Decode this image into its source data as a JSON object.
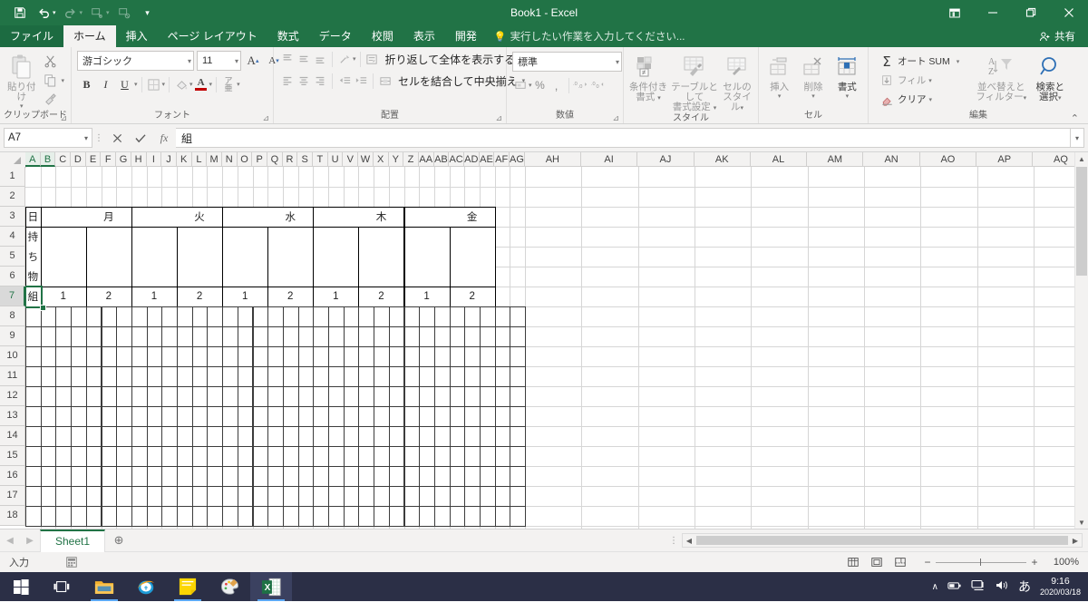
{
  "titlebar": {
    "document_title": "Book1 - Excel",
    "qat": [
      {
        "name": "save",
        "icon": "save-icon"
      },
      {
        "name": "undo",
        "icon": "undo-icon"
      },
      {
        "name": "redo",
        "icon": "redo-icon"
      },
      {
        "name": "touch-mode",
        "icon": "touch-icon"
      },
      {
        "name": "clear-all",
        "icon": "clear-icon"
      },
      {
        "name": "customize",
        "icon": "chevron-down-icon"
      }
    ],
    "ribbon_display": "ribbon-display-options-icon",
    "minimize": "minimize-icon",
    "restore": "restore-icon",
    "close": "close-icon"
  },
  "ribbon_tabs": {
    "file": "ファイル",
    "items": [
      "ホーム",
      "挿入",
      "ページ レイアウト",
      "数式",
      "データ",
      "校閲",
      "表示",
      "開発"
    ],
    "active": "ホーム",
    "tellme": "実行したい作業を入力してください...",
    "share": "共有"
  },
  "ribbon": {
    "clipboard": {
      "caption": "クリップボード",
      "paste": "貼り付け",
      "cut": "cut-icon",
      "copy": "copy-icon",
      "format_painter": "format-painter-icon"
    },
    "font": {
      "caption": "フォント",
      "font_name": "游ゴシック",
      "font_size": "11",
      "grow": "A",
      "shrink": "A",
      "bold": "B",
      "italic": "I",
      "underline": "U",
      "borders": "borders-icon",
      "fill_color": "fill-color-icon",
      "font_color": "A",
      "phonetic": "ア亜"
    },
    "alignment": {
      "caption": "配置",
      "wrap_text": "折り返して全体を表示する",
      "merge_center": "セルを結合して中央揃え",
      "orientation": "orientation-icon",
      "decrease_indent": "decrease-indent-icon",
      "increase_indent": "increase-indent-icon"
    },
    "number": {
      "caption": "数値",
      "format": "標準",
      "accounting": "accounting-icon",
      "percent": "%",
      "comma": ",",
      "increase_decimal": "増",
      "decrease_decimal": "減"
    },
    "styles": {
      "caption": "スタイル",
      "conditional": "条件付き\n書式",
      "conditional_l1": "条件付き",
      "conditional_l2": "書式",
      "table_l1": "テーブルとして",
      "table_l2": "書式設定",
      "cellstyle_l1": "セルの",
      "cellstyle_l2": "スタイル"
    },
    "cells": {
      "caption": "セル",
      "insert": "挿入",
      "delete": "削除",
      "format": "書式"
    },
    "editing": {
      "caption": "編集",
      "autosum": "オート SUM",
      "fill": "フィル",
      "clear": "クリア",
      "sort_l1": "並べ替えと",
      "sort_l2": "フィルター",
      "find_l1": "検索と",
      "find_l2": "選択",
      "collapse": "collapse-ribbon-icon"
    }
  },
  "formula_bar": {
    "name_box": "A7",
    "cancel": "cancel-icon",
    "enter": "enter-icon",
    "insert_function": "fx",
    "value": "組"
  },
  "sheet": {
    "column_headers": [
      "A",
      "B",
      "C",
      "D",
      "E",
      "F",
      "G",
      "H",
      "I",
      "J",
      "K",
      "L",
      "M",
      "N",
      "O",
      "P",
      "Q",
      "R",
      "S",
      "T",
      "U",
      "V",
      "W",
      "X",
      "Y",
      "Z",
      "AA",
      "AB",
      "AC",
      "AD",
      "AE",
      "AF",
      "AG",
      "AH",
      "AI",
      "AJ",
      "AK",
      "AL",
      "AM",
      "AN",
      "AO",
      "AP",
      "AQ"
    ],
    "selected_columns": [
      "A",
      "B"
    ],
    "row_headers": [
      "1",
      "2",
      "3",
      "4",
      "5",
      "6",
      "7",
      "8",
      "9",
      "10",
      "11",
      "12",
      "13",
      "14",
      "15",
      "16",
      "17",
      "18"
    ],
    "selected_row": "7",
    "active_cell": "A7",
    "day_headers": [
      "日",
      "月",
      "火",
      "水",
      "木",
      "金"
    ],
    "row_label_chars": [
      "持",
      "ち",
      "物"
    ],
    "row7_label": "組",
    "row7_values": [
      "1",
      "2",
      "1",
      "2",
      "1",
      "2",
      "1",
      "2",
      "1",
      "2"
    ],
    "cell_values": {
      "A3": "日",
      "A4": "持",
      "A5": "ち",
      "A6": "物",
      "A7": "組"
    }
  },
  "sheet_tabs": {
    "prev": "prev-sheet-icon",
    "next": "next-sheet-icon",
    "tabs": [
      "Sheet1"
    ],
    "active": "Sheet1",
    "add": "add-sheet-icon"
  },
  "status_bar": {
    "mode": "入力",
    "macro_record": "record-macro-icon",
    "views": [
      "normal-view-icon",
      "page-layout-view-icon",
      "page-break-view-icon"
    ],
    "zoom_out": "−",
    "zoom_in": "+",
    "zoom_level": "100%"
  },
  "taskbar": {
    "buttons": [
      {
        "name": "start-button",
        "icon": "windows-icon"
      },
      {
        "name": "task-view-button",
        "icon": "task-view-icon"
      },
      {
        "name": "file-explorer-button",
        "icon": "folder-icon"
      },
      {
        "name": "internet-explorer-button",
        "icon": "ie-icon"
      },
      {
        "name": "sticky-notes-button",
        "icon": "sticky-note-icon"
      },
      {
        "name": "paint-button",
        "icon": "paint-palette-icon"
      },
      {
        "name": "excel-button",
        "icon": "excel-icon"
      }
    ],
    "tray": {
      "expand": "show-hidden-icons-icon",
      "battery": "battery-icon",
      "network": "network-icon",
      "volume": "volume-icon",
      "ime": "あ"
    },
    "clock_time": "9:16",
    "clock_date": "2020/03/18"
  },
  "colors": {
    "excel_green": "#217346",
    "ribbon_bg": "#f3f2f1",
    "taskbar_bg": "#2b2f46",
    "grid_line": "#d6d6d6"
  }
}
